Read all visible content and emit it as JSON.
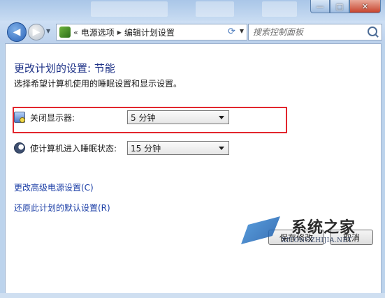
{
  "window": {
    "minimize_glyph": "—",
    "maximize_glyph": "□",
    "close_glyph": "✕"
  },
  "nav": {
    "back_glyph": "◀",
    "forward_glyph": "▶",
    "breadcrumb_prefix": "«",
    "breadcrumb": [
      "电源选项",
      "编辑计划设置"
    ],
    "search_placeholder": "搜索控制面板"
  },
  "page": {
    "title": "更改计划的设置: 节能",
    "subtitle": "选择希望计算机使用的睡眠设置和显示设置。"
  },
  "settings": {
    "display_off": {
      "label": "关闭显示器:",
      "value": "5 分钟",
      "icon": "monitor-power-icon"
    },
    "sleep": {
      "label": "使计算机进入睡眠状态:",
      "value": "15 分钟",
      "icon": "moon-icon"
    }
  },
  "links": {
    "advanced": "更改高级电源设置(C)",
    "restore": "还原此计划的默认设置(R)"
  },
  "buttons": {
    "save": "保存修改",
    "cancel": "取消"
  },
  "watermark": {
    "title": "系统之家",
    "url": "XITONGZHIJIA.NET"
  },
  "colors": {
    "title_blue": "#1e3287",
    "link_blue": "#1c3fa7",
    "highlight_red": "#e2262d"
  }
}
